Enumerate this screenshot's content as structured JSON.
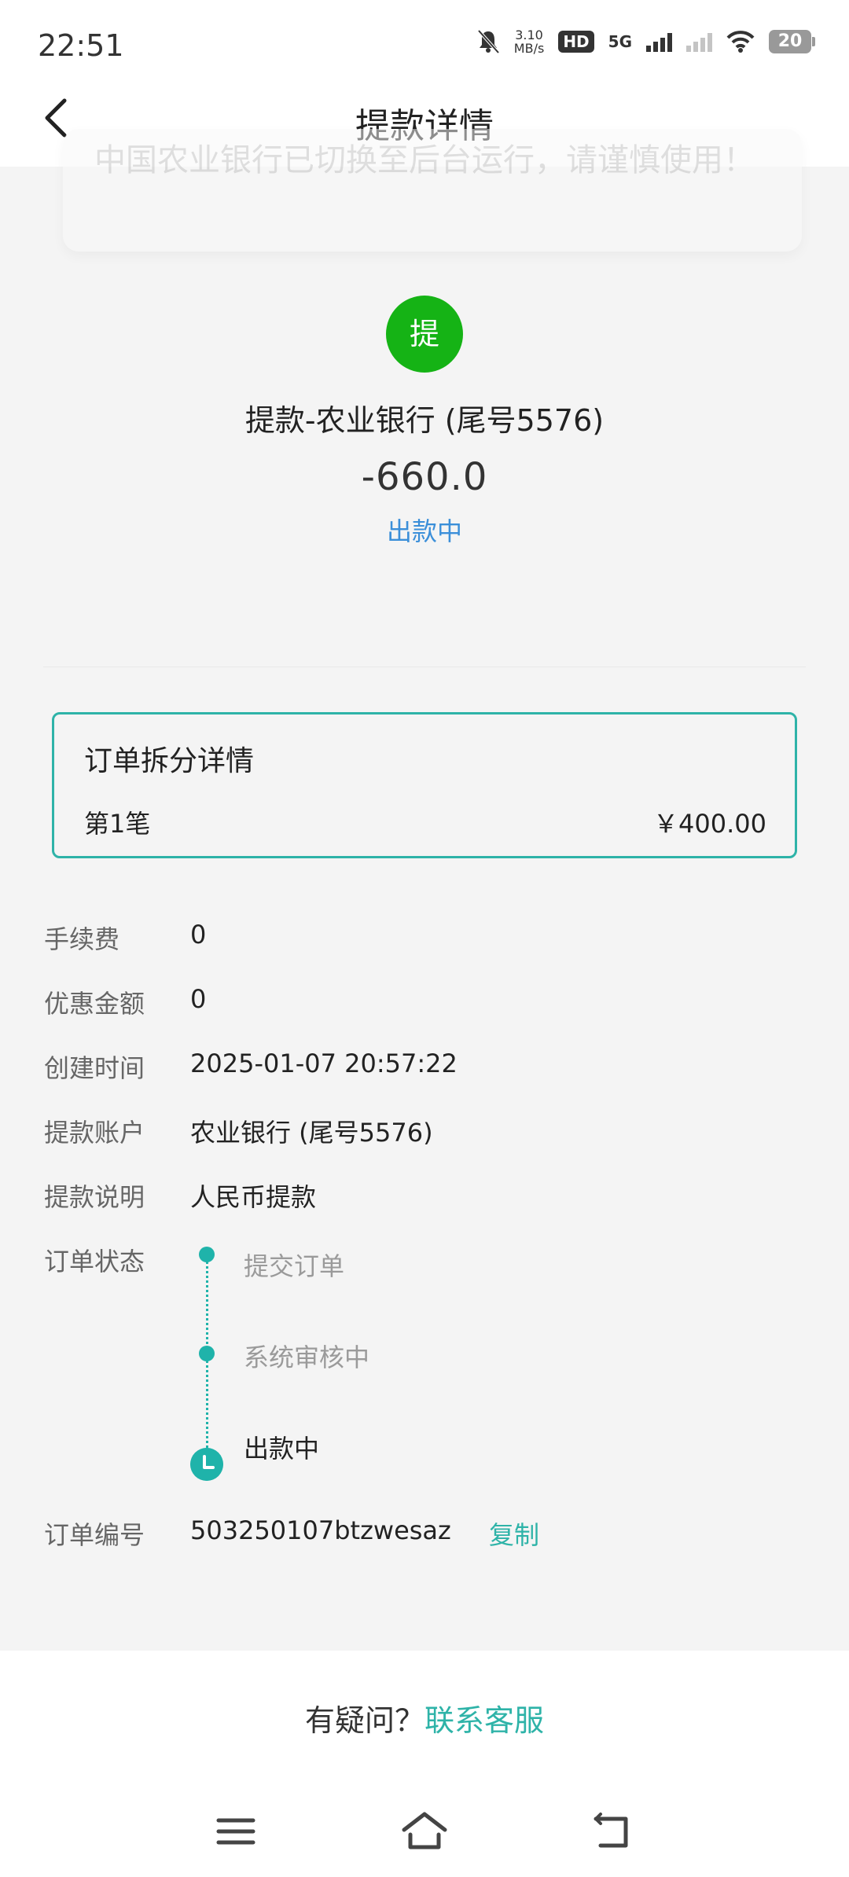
{
  "status_bar": {
    "time": "22:51",
    "speed_value": "3.10",
    "speed_unit": "MB/s",
    "hd": "HD",
    "net": "5G",
    "battery": "20"
  },
  "nav": {
    "title": "提款详情"
  },
  "toast": {
    "text": "中国农业银行已切换至后台运行，请谨慎使用！"
  },
  "transaction": {
    "badge": "提",
    "title": "提款-农业银行 (尾号5576)",
    "amount": "-660.0",
    "status": "出款中"
  },
  "split": {
    "title": "订单拆分详情",
    "items": [
      {
        "label": "第1笔",
        "amount": "￥400.00"
      }
    ]
  },
  "details": {
    "fee": {
      "label": "手续费",
      "value": "0"
    },
    "discount": {
      "label": "优惠金额",
      "value": "0"
    },
    "created": {
      "label": "创建时间",
      "value": "2025-01-07 20:57:22"
    },
    "account": {
      "label": "提款账户",
      "value": "农业银行 (尾号5576)"
    },
    "note": {
      "label": "提款说明",
      "value": "人民币提款"
    },
    "status": {
      "label": "订单状态",
      "steps": [
        {
          "text": "提交订单",
          "state": "done"
        },
        {
          "text": "系统审核中",
          "state": "done"
        },
        {
          "text": "出款中",
          "state": "current"
        }
      ]
    },
    "order_id": {
      "label": "订单编号",
      "value": "503250107btzwesaz",
      "copy": "复制"
    }
  },
  "footer": {
    "question": "有疑问？",
    "contact": "联系客服"
  },
  "colors": {
    "accent": "#2eb3a8",
    "badge": "#15b315",
    "status_link": "#3b8fd9"
  }
}
